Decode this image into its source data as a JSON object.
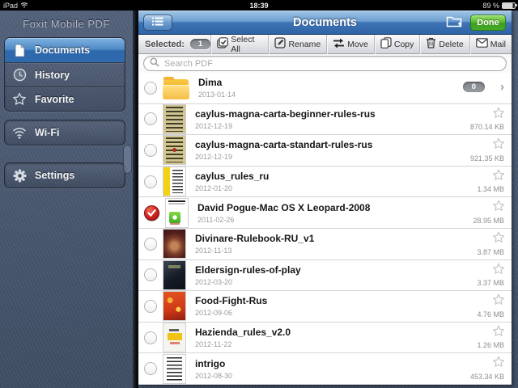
{
  "status_bar": {
    "device": "iPad",
    "time": "18:39",
    "battery_percent": "89 %"
  },
  "sidebar": {
    "title": "Foxit Mobile PDF",
    "items": [
      {
        "label": "Documents",
        "icon": "document-icon",
        "active": true
      },
      {
        "label": "History",
        "icon": "clock-icon",
        "active": false
      },
      {
        "label": "Favorite",
        "icon": "star-icon",
        "active": false
      },
      {
        "label": "Wi-Fi",
        "icon": "wifi-icon",
        "active": false
      },
      {
        "label": "Settings",
        "icon": "gear-icon",
        "active": false
      }
    ]
  },
  "navbar": {
    "title": "Documents",
    "done_label": "Done",
    "left_icon": "list-view-icon",
    "right_icon": "new-folder-icon"
  },
  "toolbar": {
    "selected_label": "Selected:",
    "selected_count": "1",
    "buttons": [
      {
        "label": "Select All",
        "icon": "select-all-icon"
      },
      {
        "label": "Rename",
        "icon": "rename-icon"
      },
      {
        "label": "Move",
        "icon": "move-icon"
      },
      {
        "label": "Copy",
        "icon": "copy-icon"
      },
      {
        "label": "Delete",
        "icon": "delete-icon"
      },
      {
        "label": "Mail",
        "icon": "mail-icon"
      }
    ]
  },
  "search": {
    "placeholder": "Search PDF",
    "icon": "search-icon"
  },
  "ui": {
    "chevron": "›"
  },
  "colors": {
    "navbar_blue": "#2e63a6",
    "done_green": "#46a828",
    "selected_red": "#cf2020",
    "badge_gray": "#8d9196",
    "star_gray": "#c8c8cd",
    "denim_blue": "#46556d"
  },
  "files": [
    {
      "name": "Dima",
      "date": "2013-01-14",
      "type": "folder",
      "badge": "0",
      "thumb": "folder"
    },
    {
      "name": "caylus-magna-carta-beginner-rules-rus",
      "date": "2012-12-19",
      "size": "870.14 KB",
      "thumb": "tan-doc"
    },
    {
      "name": "caylus-magna-carta-standart-rules-rus",
      "date": "2012-12-19",
      "size": "921.35 KB",
      "thumb": "tan-doc2"
    },
    {
      "name": "caylus_rules_ru",
      "date": "2012-01-20",
      "size": "1.34 MB",
      "thumb": "yellow-doc"
    },
    {
      "name": "David Pogue-Mac OS X Leopard-2008",
      "date": "2011-02-26",
      "size": "28.95 MB",
      "thumb": "macosx",
      "checked": true
    },
    {
      "name": "Divinare-Rulebook-RU_v1",
      "date": "2012-11-13",
      "size": "3.87 MB",
      "thumb": "maroon-cover"
    },
    {
      "name": "Eldersign-rules-of-play",
      "date": "2012-03-20",
      "size": "3.37 MB",
      "thumb": "dark-cover"
    },
    {
      "name": "Food-Fight-Rus",
      "date": "2012-09-06",
      "size": "4.76 MB",
      "thumb": "orange-cover"
    },
    {
      "name": "Hazienda_rules_v2.0",
      "date": "2012-11-22",
      "size": "1.26 MB",
      "thumb": "white-yellow-cover"
    },
    {
      "name": "intrigo",
      "date": "2012-08-30",
      "size": "453.34 KB",
      "thumb": "text-doc"
    }
  ]
}
